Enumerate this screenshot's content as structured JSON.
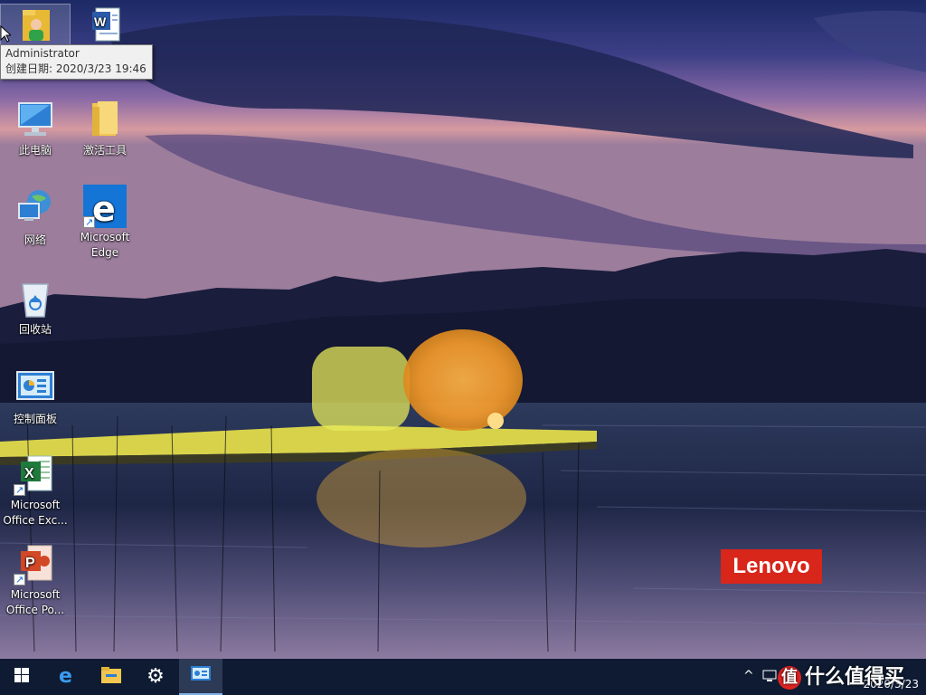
{
  "desktop": {
    "icons": [
      {
        "label": "",
        "icon": "user-folder-icon"
      },
      {
        "label": "",
        "icon": "word-document-icon"
      },
      {
        "label": "此电脑",
        "icon": "computer-icon"
      },
      {
        "label": "激活工具",
        "icon": "folder-icon"
      },
      {
        "label": "网络",
        "icon": "network-icon"
      },
      {
        "label": "Microsoft Edge",
        "icon": "edge-icon"
      },
      {
        "label": "回收站",
        "icon": "recycle-bin-icon"
      },
      {
        "label": "控制面板",
        "icon": "control-panel-icon"
      },
      {
        "label": "Microsoft Office Exc...",
        "icon": "excel-icon"
      },
      {
        "label": "Microsoft Office Po...",
        "icon": "powerpoint-icon"
      }
    ],
    "tooltip": {
      "line1": "Administrator",
      "line2": "创建日期: 2020/3/23 19:46"
    },
    "brand": "Lenovo"
  },
  "taskbar": {
    "buttons": [
      "windows-start-icon",
      "edge-icon",
      "file-explorer-icon",
      "settings-gear-icon",
      "control-panel-icon"
    ],
    "tray": {
      "chevron": "^",
      "date": "2020/3/23"
    },
    "watermark": "什么值得买",
    "watermark_badge": "值"
  },
  "colors": {
    "taskbar": "#0e1b32",
    "brand": "#d8261b"
  }
}
